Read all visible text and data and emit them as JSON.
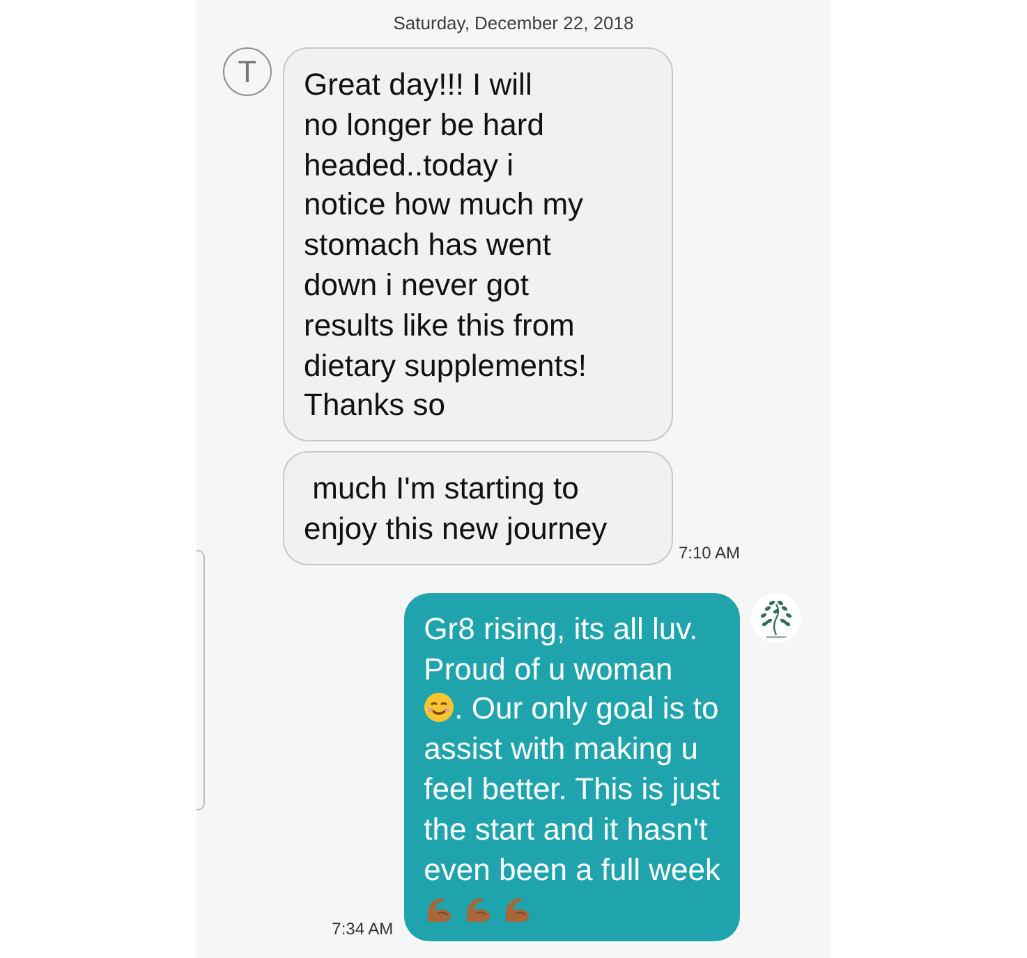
{
  "date_header": "Saturday, December 22, 2018",
  "incoming": {
    "avatar_letter": "T",
    "bubbles": [
      "Great day!!! I will\nno longer be hard\nheaded..today i\nnotice how much my\nstomach has went\ndown i never got\nresults like this from\ndietary supplements!\nThanks so",
      " much I'm starting to\nenjoy this new journey"
    ],
    "time": "7:10 AM"
  },
  "outgoing": {
    "segments": [
      {
        "kind": "text",
        "text": "Gr8 rising, its all luv.\nProud of u woman\n"
      },
      {
        "kind": "smile"
      },
      {
        "kind": "text",
        "text": ". Our only goal is to\nassist with making u\nfeel better. This is just\nthe start and it hasn't\neven been a full week\n"
      },
      {
        "kind": "flex"
      },
      {
        "kind": "flex"
      },
      {
        "kind": "flex"
      }
    ],
    "time": "7:34 AM"
  }
}
